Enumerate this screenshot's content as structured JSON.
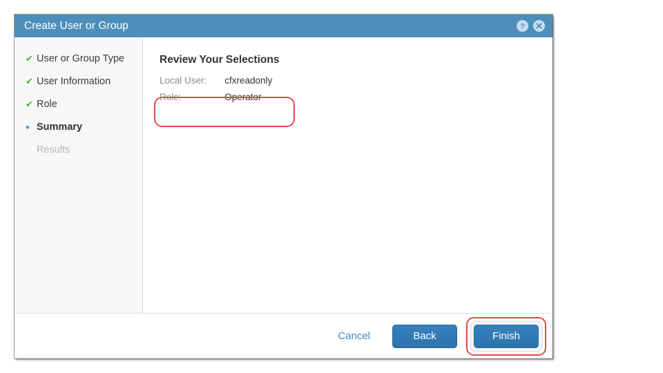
{
  "dialog": {
    "title": "Create User or Group",
    "titlebar_icons": [
      {
        "name": "help-icon",
        "glyph": "?"
      },
      {
        "name": "close-icon",
        "glyph": "×"
      }
    ]
  },
  "sidebar": {
    "steps": [
      {
        "label": "User or Group Type",
        "state": "done",
        "marker": "✔"
      },
      {
        "label": "User Information",
        "state": "done",
        "marker": "✔"
      },
      {
        "label": "Role",
        "state": "done",
        "marker": "✔"
      },
      {
        "label": "Summary",
        "state": "current",
        "marker": "•"
      },
      {
        "label": "Results",
        "state": "pending",
        "marker": ""
      }
    ]
  },
  "content": {
    "heading": "Review Your Selections",
    "summary_rows": [
      {
        "label": "Local User:",
        "value": "cfxreadonly"
      },
      {
        "label": "Role:",
        "value": "Operator"
      }
    ]
  },
  "footer": {
    "cancel_label": "Cancel",
    "back_label": "Back",
    "finish_label": "Finish"
  },
  "colors": {
    "titlebar_blue": "#4d8fba",
    "button_blue": "#2c74ae",
    "link_blue": "#3f86c6",
    "check_green": "#3cb54a",
    "current_dot_blue": "#4a90d9",
    "annotation_red": "#e24a43",
    "sidebar_bg": "#f7f7f7",
    "pending_gray": "#b6b6b6"
  }
}
